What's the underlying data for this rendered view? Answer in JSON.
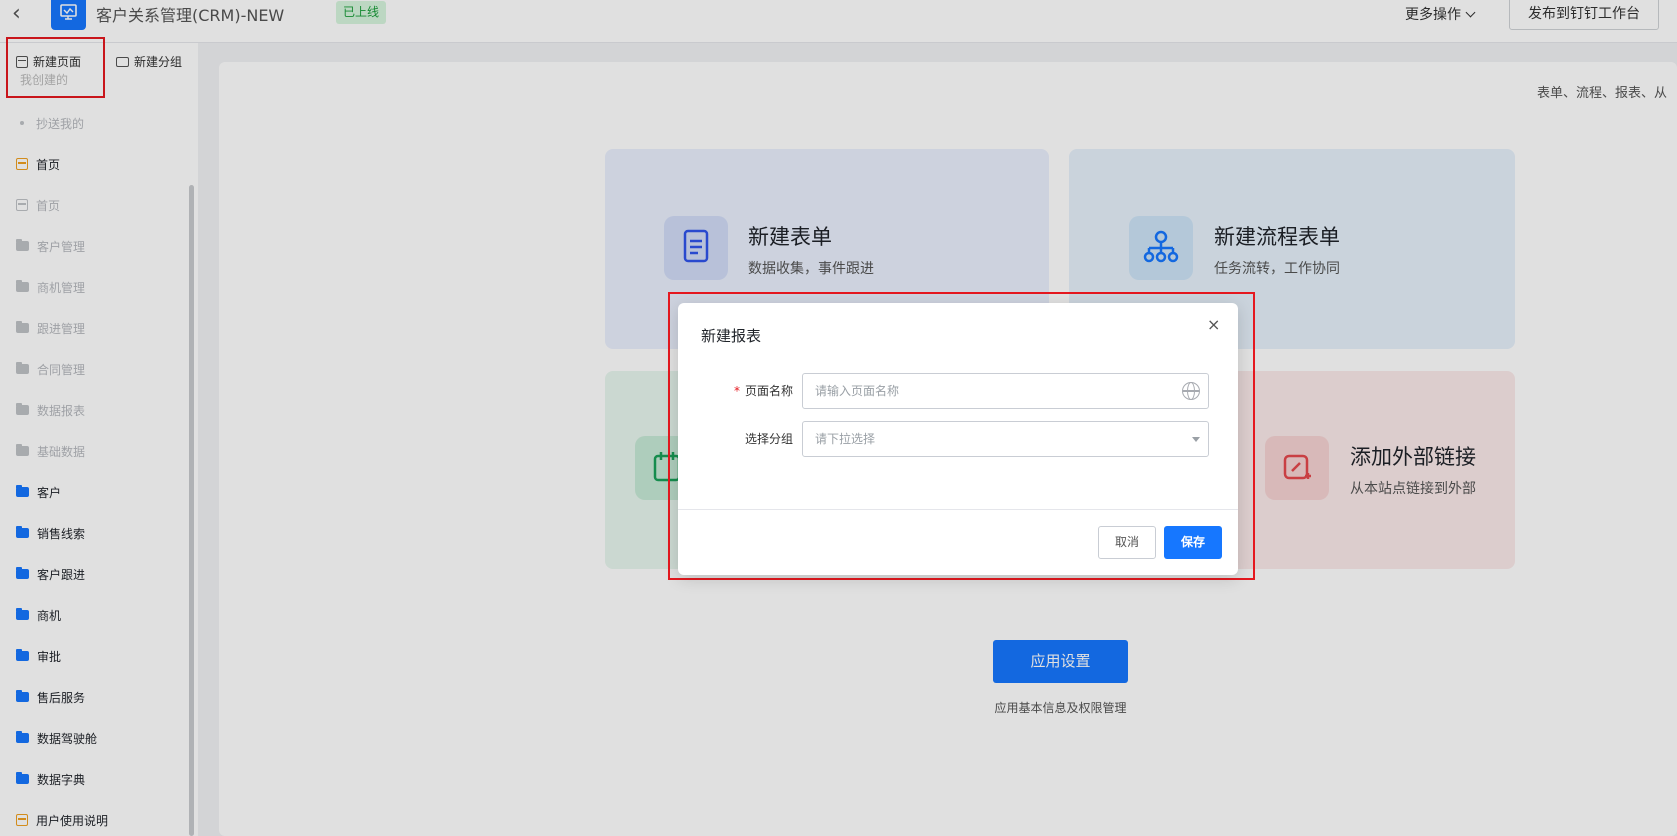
{
  "header": {
    "app_title": "客户关系管理(CRM)-NEW",
    "status_badge": "已上线",
    "more_ops": "更多操作",
    "publish_button": "发布到钉钉工作台"
  },
  "sidebar": {
    "new_page": "新建页面",
    "new_group": "新建分组",
    "faded_item": "我创建的",
    "items": [
      {
        "label": "抄送我的",
        "icon": "dot-icon",
        "style": "dim"
      },
      {
        "label": "首页",
        "icon": "page-icon",
        "style": "dark-orange"
      },
      {
        "label": "首页",
        "icon": "page-icon",
        "style": "dim"
      },
      {
        "label": "客户管理",
        "icon": "folder-icon",
        "style": "dim"
      },
      {
        "label": "商机管理",
        "icon": "folder-icon",
        "style": "dim"
      },
      {
        "label": "跟进管理",
        "icon": "folder-icon",
        "style": "dim"
      },
      {
        "label": "合同管理",
        "icon": "folder-icon",
        "style": "dim"
      },
      {
        "label": "数据报表",
        "icon": "folder-icon",
        "style": "dim"
      },
      {
        "label": "基础数据",
        "icon": "folder-icon",
        "style": "dim"
      },
      {
        "label": "客户",
        "icon": "folder-icon",
        "style": "dark-blue"
      },
      {
        "label": "销售线索",
        "icon": "folder-icon",
        "style": "dark-blue"
      },
      {
        "label": "客户跟进",
        "icon": "folder-icon",
        "style": "dark-blue"
      },
      {
        "label": "商机",
        "icon": "folder-icon",
        "style": "dark-blue"
      },
      {
        "label": "审批",
        "icon": "folder-icon",
        "style": "dark-blue"
      },
      {
        "label": "售后服务",
        "icon": "folder-icon",
        "style": "dark-blue"
      },
      {
        "label": "数据驾驶舱",
        "icon": "folder-icon",
        "style": "dark-blue"
      },
      {
        "label": "数据字典",
        "icon": "folder-icon",
        "style": "dark-blue"
      },
      {
        "label": "用户使用说明",
        "icon": "page-icon",
        "style": "dark-orange"
      }
    ]
  },
  "main": {
    "hint": "表单、流程、报表、从",
    "cards": {
      "form": {
        "title": "新建表单",
        "subtitle": "数据收集，事件跟进"
      },
      "flow": {
        "title": "新建流程表单",
        "subtitle": "任务流转，工作协同"
      },
      "link": {
        "title": "添加外部链接",
        "subtitle": "从本站点链接到外部"
      }
    },
    "settings_button": "应用设置",
    "settings_subtitle": "应用基本信息及权限管理"
  },
  "modal": {
    "title": "新建报表",
    "close": "×",
    "required_mark": "*",
    "page_name_label": "页面名称",
    "page_name_placeholder": "请输入页面名称",
    "group_label": "选择分组",
    "group_placeholder": "请下拉选择",
    "cancel": "取消",
    "save": "保存"
  },
  "colors": {
    "accent": "#1677ff",
    "highlight_border": "#e5181f",
    "badge_bg": "#d6f5dd",
    "badge_text": "#1a9e3a"
  }
}
